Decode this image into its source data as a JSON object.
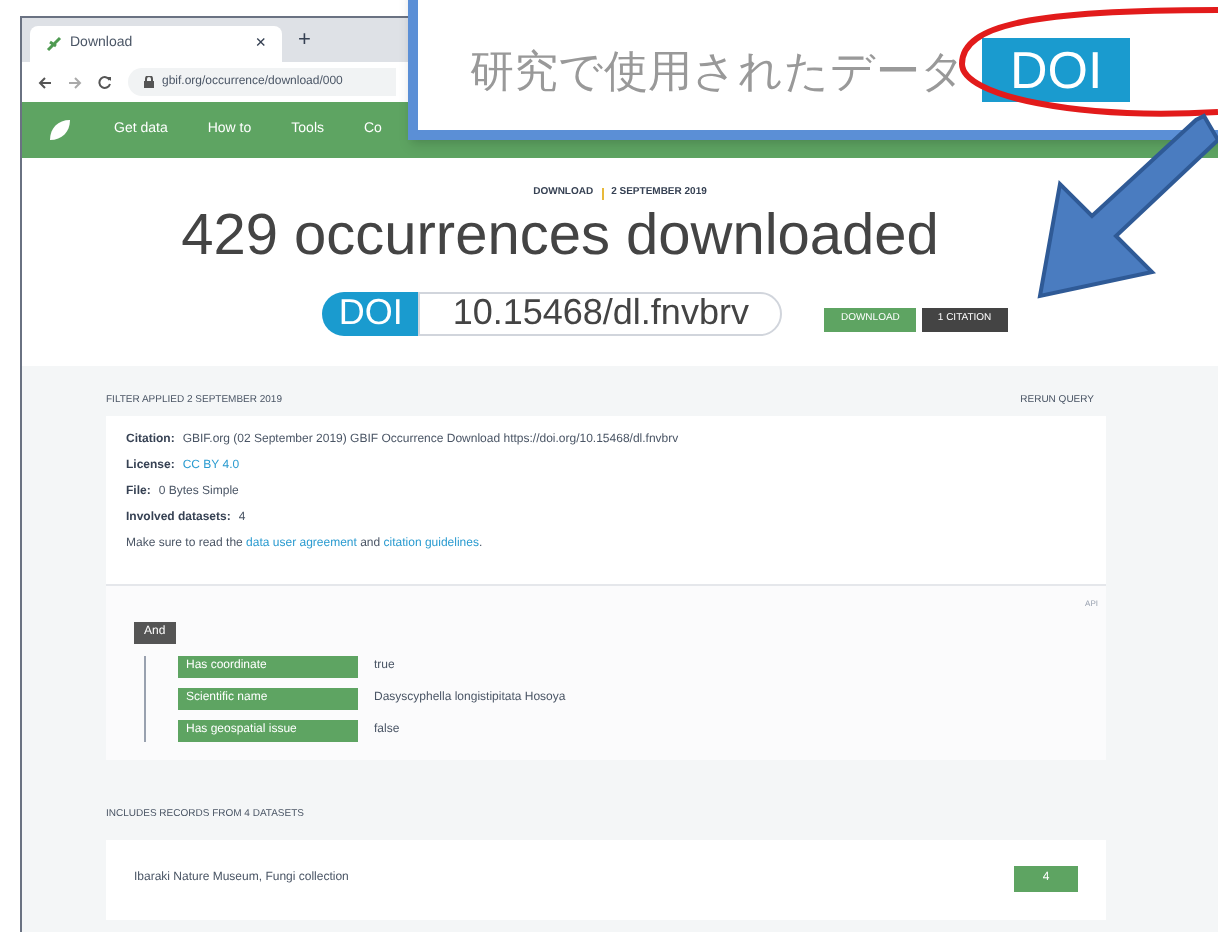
{
  "browser": {
    "tab_title": "Download",
    "tab_close": "×",
    "new_tab": "+",
    "url": "gbif.org/occurrence/download/000"
  },
  "nav": {
    "items": [
      "Get data",
      "How to",
      "Tools",
      "Co"
    ]
  },
  "callout": {
    "text": "研究で使用されたデータ",
    "badge": "DOI"
  },
  "header": {
    "kicker": "DOWNLOAD",
    "date": "2 SEPTEMBER 2019",
    "title": "429 occurrences downloaded",
    "doi_label": "DOI",
    "doi": "10.15468/dl.fnvbrv",
    "buttons": [
      "DOWNLOAD",
      "1 CITATION"
    ]
  },
  "filter_section": {
    "heading": "FILTER APPLIED 2 SEPTEMBER 2019",
    "rerun": "RERUN QUERY",
    "details": [
      {
        "label": "Citation:",
        "value": "GBIF.org (02 September 2019) GBIF Occurrence Download https://doi.org/10.15468/dl.fnvbrv",
        "kind": "text"
      },
      {
        "label": "License:",
        "value": "CC BY 4.0",
        "kind": "link"
      },
      {
        "label": "File:",
        "value": "0 Bytes Simple",
        "kind": "text"
      },
      {
        "label": "Involved datasets:",
        "value": "4",
        "kind": "text"
      }
    ],
    "note": [
      "Make sure to read the ",
      "data user agreement",
      " and ",
      "citation guidelines",
      "."
    ],
    "api": "API",
    "operator": "And",
    "filters": [
      {
        "name": "Has coordinate",
        "value": "true"
      },
      {
        "name": "Scientific name",
        "value": "Dasyscyphella longistipitata Hosoya"
      },
      {
        "name": "Has geospatial issue",
        "value": "false"
      }
    ]
  },
  "datasets": {
    "heading": "INCLUDES RECORDS FROM 4 DATASETS",
    "items": [
      {
        "name": "Ibaraki Nature Museum, Fungi collection",
        "count": "4"
      }
    ]
  }
}
